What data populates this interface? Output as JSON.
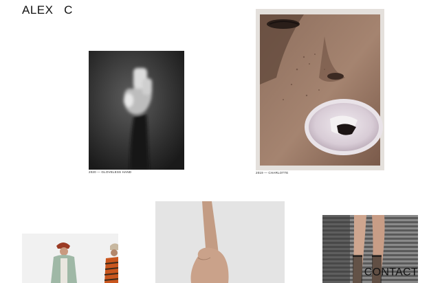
{
  "header": {
    "logo_text": "ALEX   C"
  },
  "works": [
    {
      "caption": "2020 — GLOVELESS HAND",
      "image": "gloveless-hand-photo"
    },
    {
      "caption": "2019 — CHARLOTTE",
      "image": "bubblegum-portrait-photo"
    },
    {
      "caption": "",
      "image": "fashion-figures-photo"
    },
    {
      "caption": "",
      "image": "hand-on-grey-photo"
    },
    {
      "caption": "",
      "image": "legs-stockings-photo"
    }
  ],
  "footer": {
    "contact_label": "CONTACT"
  },
  "colors": {
    "background": "#ffffff",
    "text": "#111111"
  }
}
